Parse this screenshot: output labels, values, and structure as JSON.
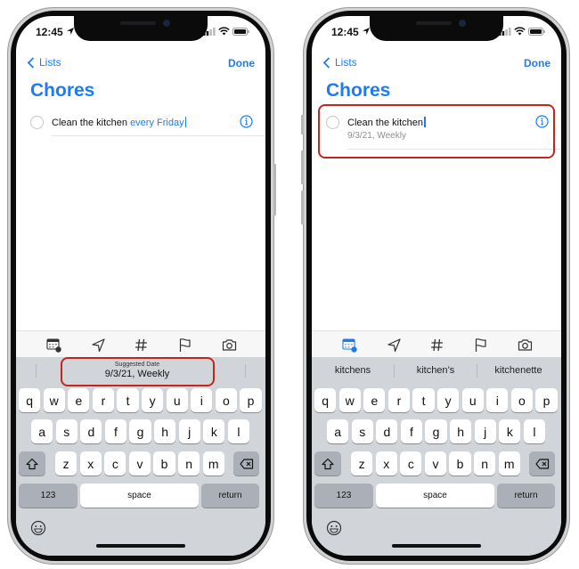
{
  "colors": {
    "accent": "#1d7cf2",
    "annotation": "#c0281e",
    "keyboard_bg": "#d1d4d9"
  },
  "screens": [
    {
      "status": {
        "time": "12:45",
        "icons": [
          "location-arrow-icon",
          "cellular-signal-icon",
          "wifi-icon",
          "battery-icon"
        ]
      },
      "nav": {
        "back_label": "Lists",
        "done_label": "Done"
      },
      "list_title": "Chores",
      "reminder": {
        "text": "Clean the kitchen ",
        "highlighted_text": "every Friday",
        "subtitle": ""
      },
      "toolbar": [
        "calendar-date-icon",
        "location-arrow-icon",
        "hashtag-icon",
        "flag-icon",
        "camera-icon"
      ],
      "suggestion_bar": {
        "type": "suggested-date",
        "label": "Suggested Date",
        "value": "9/3/21, Weekly"
      }
    },
    {
      "status": {
        "time": "12:45",
        "icons": [
          "location-arrow-icon",
          "cellular-signal-icon",
          "wifi-icon",
          "battery-icon"
        ]
      },
      "nav": {
        "back_label": "Lists",
        "done_label": "Done"
      },
      "list_title": "Chores",
      "reminder": {
        "text": "Clean the kitchen",
        "highlighted_text": "",
        "subtitle": "9/3/21, Weekly"
      },
      "toolbar": [
        "calendar-date-icon",
        "location-arrow-icon",
        "hashtag-icon",
        "flag-icon",
        "camera-icon"
      ],
      "suggestion_bar": {
        "type": "word-suggestions",
        "words": [
          "kitchens",
          "kitchen’s",
          "kitchenette"
        ]
      }
    }
  ],
  "keyboard": {
    "row1": [
      "q",
      "w",
      "e",
      "r",
      "t",
      "y",
      "u",
      "i",
      "o",
      "p"
    ],
    "row2": [
      "a",
      "s",
      "d",
      "f",
      "g",
      "h",
      "j",
      "k",
      "l"
    ],
    "row3": [
      "z",
      "x",
      "c",
      "v",
      "b",
      "n",
      "m"
    ],
    "numbers_label": "123",
    "space_label": "space",
    "return_label": "return"
  }
}
